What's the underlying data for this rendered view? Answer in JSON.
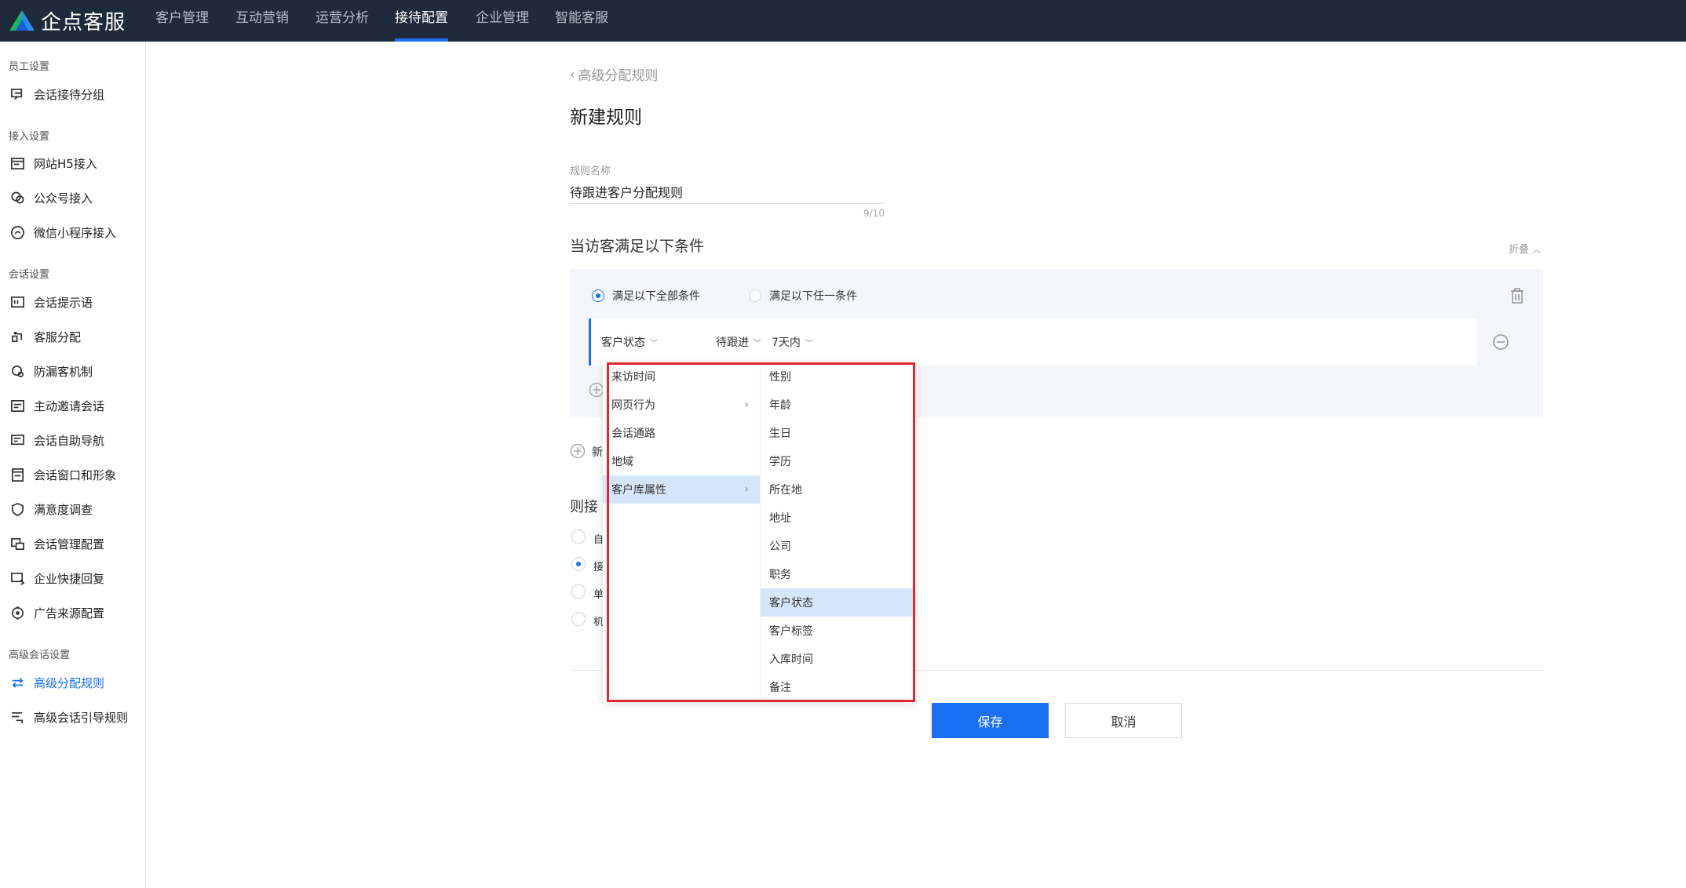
{
  "app": {
    "logo_text": "企点客服"
  },
  "nav": {
    "items": [
      "客户管理",
      "互动营销",
      "运营分析",
      "接待配置",
      "企业管理",
      "智能客服"
    ],
    "active": "接待配置"
  },
  "sidebar": {
    "groups": [
      {
        "title": "员工设置",
        "items": [
          {
            "label": "会话接待分组",
            "icon": "chat-group-icon"
          }
        ]
      },
      {
        "title": "接入设置",
        "items": [
          {
            "label": "网站H5接入",
            "icon": "web-icon"
          },
          {
            "label": "公众号接入",
            "icon": "wechat-icon"
          },
          {
            "label": "微信小程序接入",
            "icon": "miniprogram-icon"
          }
        ]
      },
      {
        "title": "会话设置",
        "items": [
          {
            "label": "会话提示语",
            "icon": "prompt-icon"
          },
          {
            "label": "客服分配",
            "icon": "assign-icon"
          },
          {
            "label": "防漏客机制",
            "icon": "anti-leak-icon"
          },
          {
            "label": "主动邀请会话",
            "icon": "invite-icon"
          },
          {
            "label": "会话自助导航",
            "icon": "nav-icon"
          },
          {
            "label": "会话窗口和形象",
            "icon": "window-icon"
          },
          {
            "label": "满意度调查",
            "icon": "survey-icon"
          },
          {
            "label": "会话管理配置",
            "icon": "manage-icon"
          },
          {
            "label": "企业快捷回复",
            "icon": "quick-reply-icon"
          },
          {
            "label": "广告来源配置",
            "icon": "ad-source-icon"
          }
        ]
      },
      {
        "title": "高级会话设置",
        "items": [
          {
            "label": "高级分配规则",
            "icon": "advanced-assign-icon",
            "active": true
          },
          {
            "label": "高级会话引导规则",
            "icon": "guide-icon"
          }
        ]
      }
    ]
  },
  "main": {
    "back_label": "高级分配规则",
    "title": "新建规则",
    "name_field": {
      "label": "规则名称",
      "value": "待跟进客户分配规则",
      "counter": "9/10"
    },
    "conditions": {
      "title": "当访客满足以下条件",
      "collapse_label": "折叠",
      "match_all": "满足以下全部条件",
      "match_any": "满足以下任一条件",
      "row": {
        "field": "客户状态",
        "value": "待跟进",
        "time": "7天内"
      },
      "add_group_partial": "新"
    },
    "then_title_partial": "则接",
    "options_partial": [
      "自",
      "接",
      "单",
      "机"
    ],
    "buttons": {
      "save": "保存",
      "cancel": "取消"
    }
  },
  "cascader": {
    "col1": [
      "来访时间",
      "网页行为",
      "会话通路",
      "地域",
      "客户库属性"
    ],
    "col1_has_children": [
      false,
      true,
      false,
      false,
      true
    ],
    "col1_selected": 4,
    "col2": [
      "性别",
      "年龄",
      "生日",
      "学历",
      "所在地",
      "地址",
      "公司",
      "职务",
      "客户状态",
      "客户标签",
      "入库时间",
      "备注"
    ],
    "col2_selected": 8
  },
  "colors": {
    "accent": "#1a6ff5",
    "nav_bg": "#1f2a3a",
    "highlight": "#e0282e",
    "selected_bg": "#d5e6fb"
  }
}
